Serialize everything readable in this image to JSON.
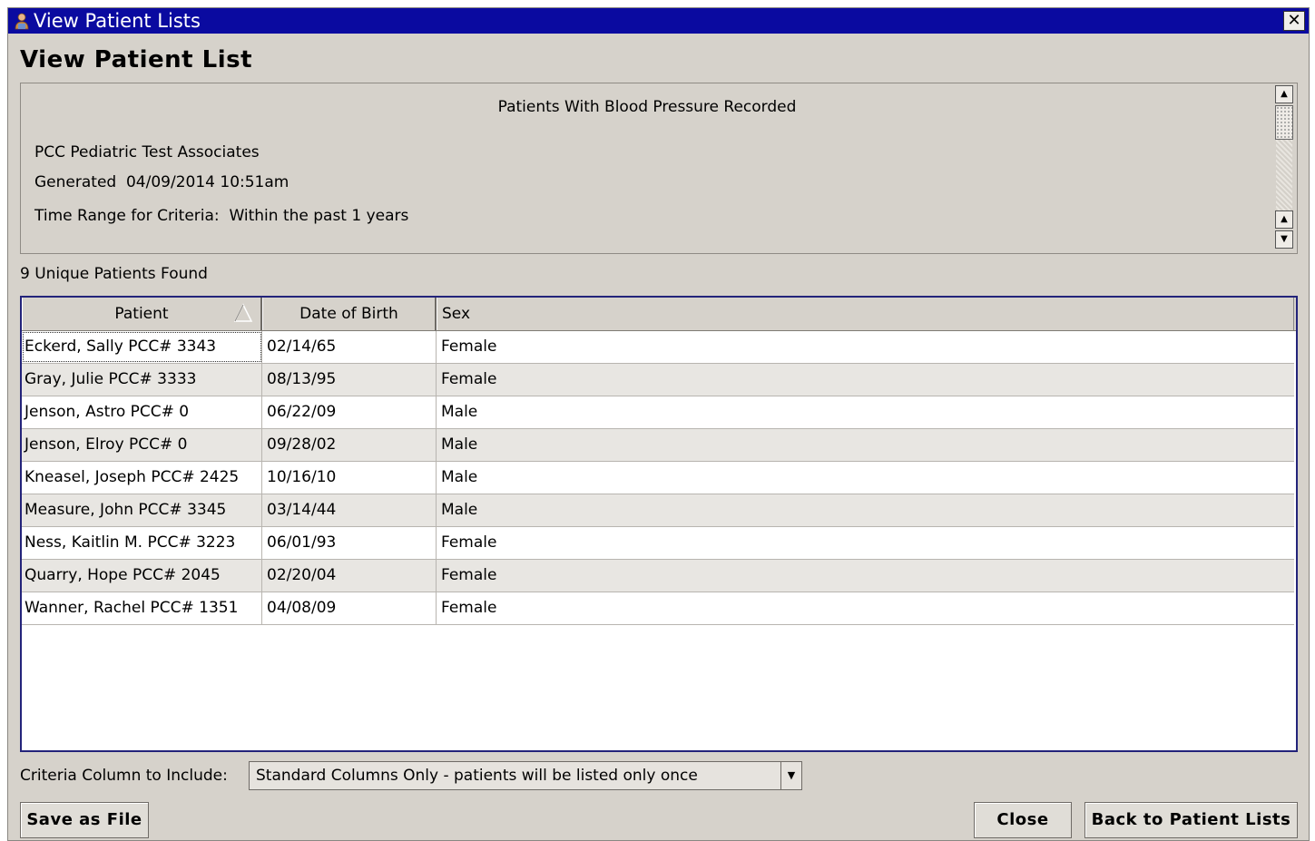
{
  "window": {
    "title": "View Patient Lists",
    "close_label": "✕"
  },
  "page": {
    "heading": "View Patient List"
  },
  "report": {
    "title": "Patients With Blood Pressure Recorded",
    "practice": "PCC Pediatric Test Associates",
    "generated": "Generated  04/09/2014 10:51am",
    "time_range": "Time Range for Criteria:  Within the past 1 years"
  },
  "summary": {
    "count_text": "9 Unique Patients Found"
  },
  "table": {
    "columns": [
      "Patient",
      "Date of Birth",
      "Sex"
    ],
    "rows": [
      [
        "Eckerd, Sally PCC# 3343",
        "02/14/65",
        "Female"
      ],
      [
        "Gray, Julie PCC# 3333",
        "08/13/95",
        "Female"
      ],
      [
        "Jenson, Astro PCC# 0",
        "06/22/09",
        "Male"
      ],
      [
        "Jenson, Elroy PCC# 0",
        "09/28/02",
        "Male"
      ],
      [
        "Kneasel, Joseph PCC# 2425",
        "10/16/10",
        "Male"
      ],
      [
        "Measure, John PCC# 3345",
        "03/14/44",
        "Male"
      ],
      [
        "Ness, Kaitlin M. PCC# 3223",
        "06/01/93",
        "Female"
      ],
      [
        "Quarry, Hope PCC# 2045",
        "02/20/04",
        "Female"
      ],
      [
        "Wanner, Rachel PCC# 1351",
        "04/08/09",
        "Female"
      ]
    ]
  },
  "criteria": {
    "label": "Criteria Column to Include:",
    "selected": "Standard Columns Only - patients will be listed only once"
  },
  "buttons": {
    "save": "Save as File",
    "close": "Close",
    "back": "Back to Patient Lists"
  },
  "colors": {
    "titlebar": "#0a0aa0",
    "window_bg": "#d6d2cb",
    "table_border": "#23237a",
    "row_alt": "#e8e6e2"
  }
}
